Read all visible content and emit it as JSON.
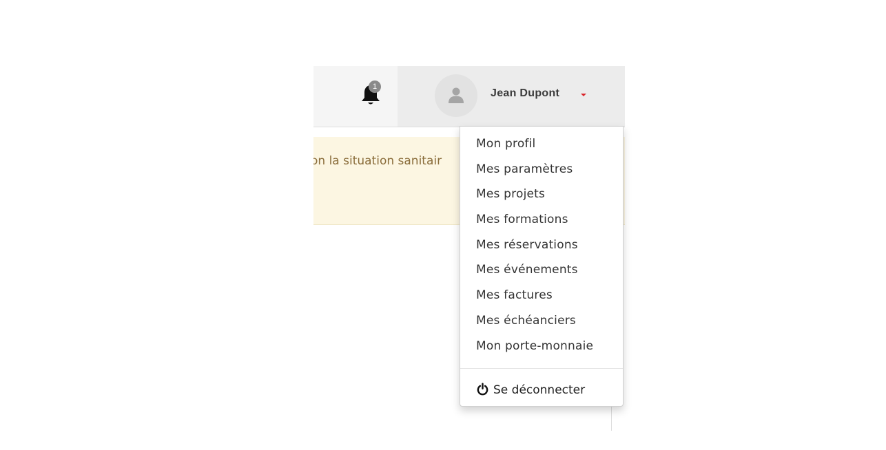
{
  "header": {
    "notifications": {
      "icon": "bell-icon",
      "count": "1"
    },
    "user": {
      "avatar_icon": "user-avatar-icon",
      "name": "Jean Dupont",
      "caret_color": "#d9262c"
    }
  },
  "alert": {
    "text": "on la situation sanitair"
  },
  "dropdown": {
    "items": [
      {
        "label": "Mon profil"
      },
      {
        "label": "Mes paramètres"
      },
      {
        "label": "Mes projets"
      },
      {
        "label": "Mes formations"
      },
      {
        "label": "Mes réservations"
      },
      {
        "label": "Mes événements"
      },
      {
        "label": "Mes factures"
      },
      {
        "label": "Mes échéanciers"
      },
      {
        "label": "Mon porte-monnaie"
      }
    ],
    "logout": {
      "icon": "power-icon",
      "label": "Se déconnecter"
    }
  },
  "colors": {
    "alert_bg": "#fcf6e2",
    "alert_text": "#8a6d3b",
    "topbar_bg": "#f5f5f5",
    "user_area_bg": "#ececec"
  }
}
